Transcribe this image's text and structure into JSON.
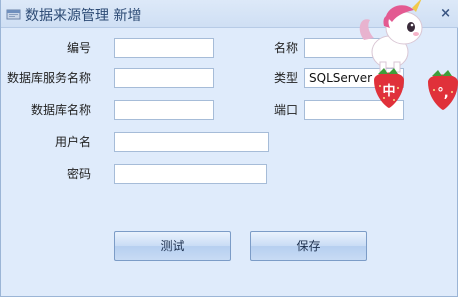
{
  "window": {
    "title": "数据来源管理 新增",
    "close_glyph": "×"
  },
  "form": {
    "number_label": "编号",
    "number_value": "",
    "name_label": "名称",
    "name_value": "",
    "db_service_label": "数据库服务名称",
    "db_service_value": "",
    "type_label": "类型",
    "type_value": "SQLServer",
    "db_name_label": "数据库名称",
    "db_name_value": "",
    "port_label": "端口",
    "port_value": "",
    "username_label": "用户名",
    "username_value": "",
    "password_label": "密码",
    "password_value": ""
  },
  "buttons": {
    "test_label": "测试",
    "save_label": "保存"
  },
  "overlay": {
    "badge_left_char": "中",
    "badge_right_char": "°,"
  }
}
